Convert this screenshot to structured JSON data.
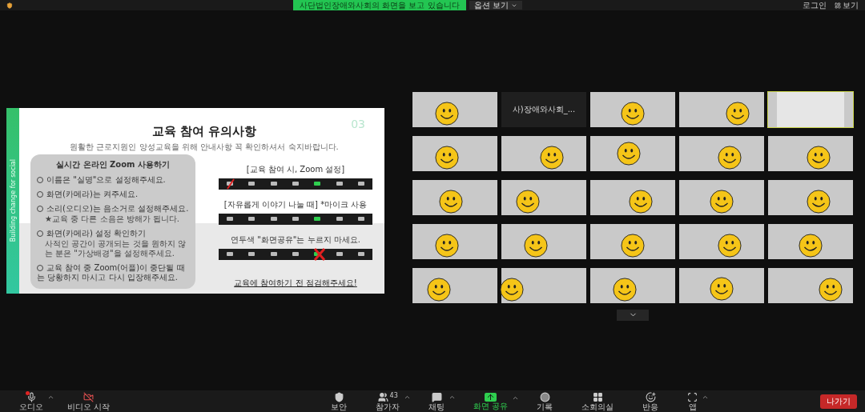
{
  "top_bar": {
    "banner": "사단법인장애와사회의 화면을 보고 있습니다",
    "options": "옵션 보기",
    "login": "로그인",
    "view": "보기"
  },
  "slide": {
    "title": "교육 참여 유의사항",
    "subtitle": "원활한 근로지원인 양성교육을 위해 안내사항 꼭 확인하셔서 숙지바랍니다.",
    "page_number": "03",
    "side_text": "Building change for social",
    "card": {
      "title": "실시간 온라인 Zoom 사용하기",
      "items": [
        {
          "text": "이름은 \"실명\"으로 설정해주세요."
        },
        {
          "text": "화면(카메라)는 켜주세요."
        },
        {
          "text": "소리(오디오)는 음소거로 설정해주세요.",
          "note": "★교육 중 다른 소음은 방해가 됩니다."
        },
        {
          "text": "화면(카메라) 설정 확인하기",
          "note": "사적인 공간이 공개되는 것을 원하지 않는 분은 \"가상배경\"을 설정해주세요."
        },
        {
          "text": "교육 참여 중 Zoom(어플)이 중단될 때는 당황하지 마시고 다시 입장해주세요."
        }
      ]
    },
    "sections": [
      {
        "caption": "[교육 참여 시, Zoom 설정]",
        "kind": "mic-muted"
      },
      {
        "caption": "[자유롭게 이야기 나눌 때] *마이크 사용",
        "kind": "mic-on"
      },
      {
        "caption": "연두색 \"화면공유\"는 누르지 마세요.",
        "kind": "share-blocked"
      }
    ],
    "footer": "교육에 참여하기 전 점검해주세요!"
  },
  "gallery": {
    "tiles": [
      {
        "kind": "video",
        "selected": false
      },
      {
        "kind": "name",
        "name": "사)장애와사회_...",
        "selected": false
      },
      {
        "kind": "video",
        "selected": false
      },
      {
        "kind": "video",
        "selected": false
      },
      {
        "kind": "self",
        "selected": true
      },
      {
        "kind": "video",
        "selected": false
      },
      {
        "kind": "video",
        "selected": false
      },
      {
        "kind": "video",
        "selected": false
      },
      {
        "kind": "video",
        "selected": false
      },
      {
        "kind": "video",
        "selected": false
      },
      {
        "kind": "video",
        "selected": false
      },
      {
        "kind": "video",
        "selected": false
      },
      {
        "kind": "video",
        "selected": false
      },
      {
        "kind": "video",
        "selected": false
      },
      {
        "kind": "video",
        "selected": false
      },
      {
        "kind": "video",
        "selected": false
      },
      {
        "kind": "video",
        "selected": false
      },
      {
        "kind": "video",
        "selected": false
      },
      {
        "kind": "video",
        "selected": false
      },
      {
        "kind": "video",
        "selected": false
      },
      {
        "kind": "video",
        "selected": false
      },
      {
        "kind": "video",
        "selected": false
      },
      {
        "kind": "video",
        "selected": false
      },
      {
        "kind": "video",
        "selected": false
      },
      {
        "kind": "video",
        "selected": false
      }
    ]
  },
  "toolbar": {
    "left": [
      {
        "kind": "audio",
        "label": "오디오",
        "caret": true,
        "alert": true
      },
      {
        "kind": "video-off",
        "label": "비디오 시작",
        "caret": false
      }
    ],
    "center": [
      {
        "kind": "security",
        "label": "보안",
        "caret": false
      },
      {
        "kind": "participants",
        "label": "참가자",
        "count": "43",
        "caret": true
      },
      {
        "kind": "chat",
        "label": "채팅",
        "caret": true
      },
      {
        "kind": "share",
        "label": "화면 공유",
        "caret": true,
        "highlighted": true
      },
      {
        "kind": "record",
        "label": "기록",
        "caret": false
      },
      {
        "kind": "rooms",
        "label": "소회의실",
        "caret": false
      },
      {
        "kind": "reactions",
        "label": "반응",
        "caret": false
      },
      {
        "kind": "apps",
        "label": "앱",
        "caret": true
      }
    ],
    "leave": "나가기"
  }
}
